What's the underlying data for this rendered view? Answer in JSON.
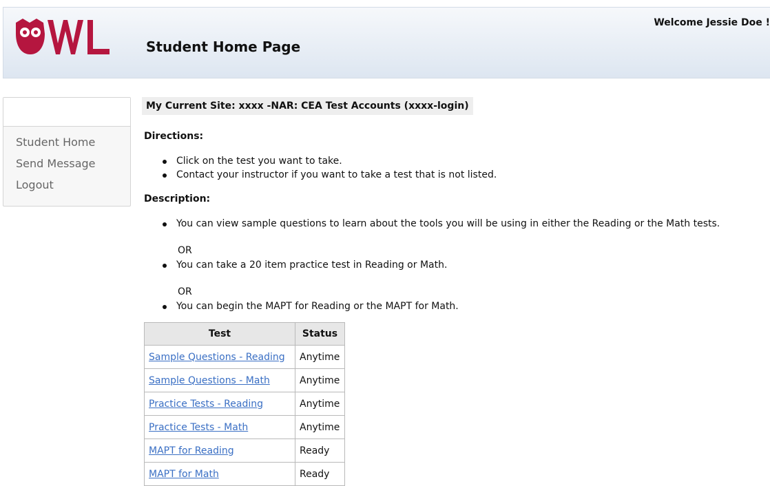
{
  "header": {
    "logo_text": "OWL",
    "page_title": "Student Home Page",
    "welcome": "Welcome Jessie Doe !",
    "brand_color": "#b5163f"
  },
  "sidebar": {
    "items": [
      {
        "label": "Student Home"
      },
      {
        "label": "Send Message"
      },
      {
        "label": "Logout"
      }
    ]
  },
  "main": {
    "current_site": "My Current Site: xxxx -NAR: CEA Test Accounts (xxxx-login)",
    "directions": {
      "heading": "Directions:",
      "items": [
        "Click on the test you want to take.",
        "Contact your instructor if you want to take a test that is not listed."
      ]
    },
    "description": {
      "heading": "Description:",
      "items": [
        "You can view sample questions to learn about the tools you will be using in either the Reading or the Math tests.",
        "You can take a 20 item practice test in Reading or Math.",
        "You can begin the MAPT for Reading or the MAPT for Math."
      ],
      "or_label": "OR"
    },
    "table": {
      "headers": [
        "Test",
        "Status"
      ],
      "rows": [
        {
          "test": "Sample Questions - Reading",
          "status": "Anytime"
        },
        {
          "test": "Sample Questions - Math",
          "status": "Anytime"
        },
        {
          "test": "Practice Tests - Reading",
          "status": "Anytime"
        },
        {
          "test": "Practice Tests - Math",
          "status": "Anytime"
        },
        {
          "test": "MAPT for Reading",
          "status": "Ready"
        },
        {
          "test": "MAPT for Math",
          "status": "Ready"
        }
      ]
    }
  }
}
